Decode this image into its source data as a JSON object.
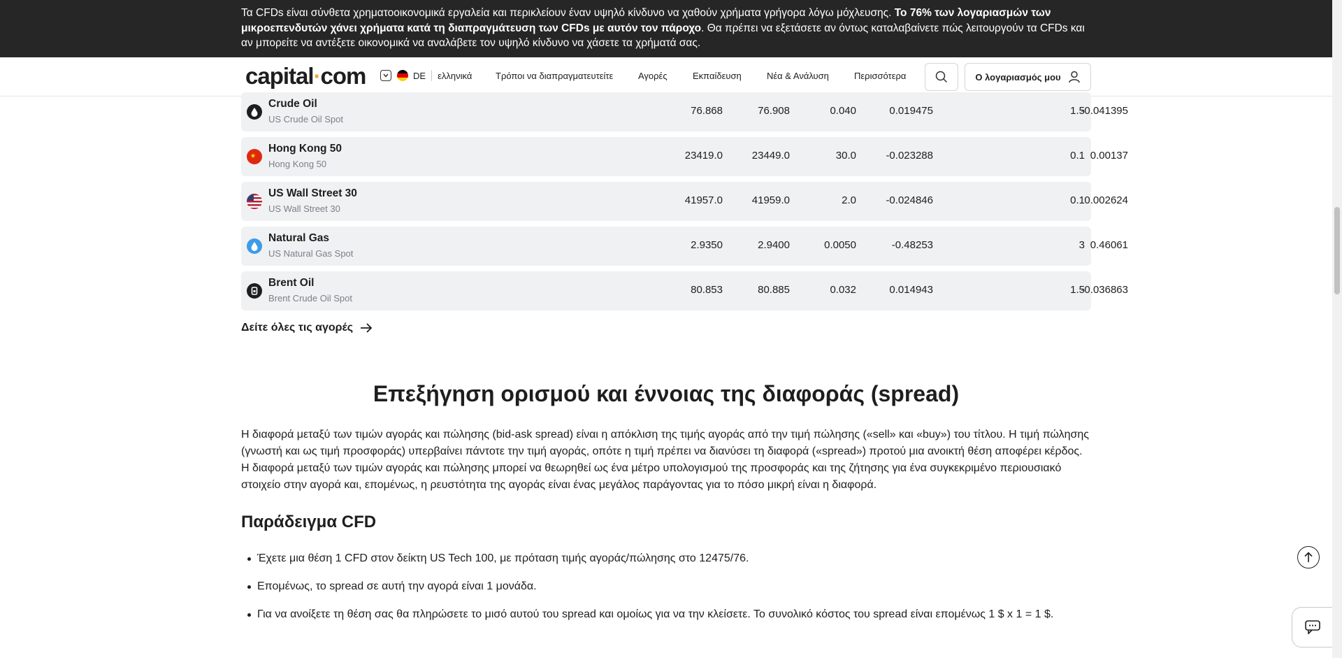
{
  "risk_banner": {
    "text_1": "Τα CFDs είναι σύνθετα χρηματοοικονομικά εργαλεία και περικλείουν έναν υψηλό κίνδυνο να χαθούν χρήματα γρήγορα λόγω μόχλευσης. ",
    "text_bold": "Το 76% των λογαριασμών των μικροεπενδυτών χάνει χρήματα κατά τη διαπραγμάτευση των CFDs με αυτόν τον πάροχο",
    "text_2": ". Θα πρέπει να εξετάσετε αν όντως καταλαβαίνετε πώς λειτουργούν τα CFDs και αν μπορείτε να αντέξετε οικονομικά να αναλάβετε τον υψηλό κίνδυνο να χάσετε τα χρήματά σας."
  },
  "header": {
    "logo_left": "capital",
    "logo_dot": "·",
    "logo_right": "com",
    "lang_code": "DE",
    "lang_name": "ελληνικά",
    "nav": [
      "Τρόποι να διαπραγματευτείτε",
      "Αγορές",
      "Εκπαίδευση",
      "Νέα & Ανάλυση",
      "Περισσότερα"
    ],
    "account_label": "Ο λογαριασμός μου"
  },
  "markets": [
    {
      "name": "Crude Oil",
      "sub": "US Crude Oil Spot",
      "sell": "76.868",
      "buy": "76.908",
      "spread": "0.040",
      "long": "0.019475",
      "short": "-0.041395",
      "margin": "1.5",
      "icon": "oil-drop-icon"
    },
    {
      "name": "Hong Kong 50",
      "sub": "Hong Kong 50",
      "sell": "23419.0",
      "buy": "23449.0",
      "spread": "30.0",
      "long": "-0.023288",
      "short": "0.00137",
      "margin": "0.1",
      "icon": "china-flag-icon"
    },
    {
      "name": "US Wall Street 30",
      "sub": "US Wall Street 30",
      "sell": "41957.0",
      "buy": "41959.0",
      "spread": "2.0",
      "long": "-0.024846",
      "short": "0.002624",
      "margin": "0.1",
      "icon": "us-flag-icon"
    },
    {
      "name": "Natural Gas",
      "sub": "US Natural Gas Spot",
      "sell": "2.9350",
      "buy": "2.9400",
      "spread": "0.0050",
      "long": "-0.48253",
      "short": "0.46061",
      "margin": "3",
      "icon": "gas-drop-icon"
    },
    {
      "name": "Brent Oil",
      "sub": "Brent Crude Oil Spot",
      "sell": "80.853",
      "buy": "80.885",
      "spread": "0.032",
      "long": "0.014943",
      "short": "-0.036863",
      "margin": "1.5",
      "icon": "barrel-icon"
    }
  ],
  "see_all_label": "Δείτε όλες τις αγορές",
  "section": {
    "title": "Επεξήγηση ορισμού και έννοιας της διαφοράς (spread)",
    "paragraph": "Η διαφορά μεταξύ των τιμών αγοράς και πώλησης (bid-ask spread) είναι η απόκλιση της τιμής αγοράς από την τιμή πώλησης («sell» και «buy») του τίτλου. Η τιμή πώλησης (γνωστή και ως τιμή προσφοράς) υπερβαίνει πάντοτε την τιμή αγοράς, οπότε η τιμή πρέπει να διανύσει τη διαφορά («spread») προτού μια ανοικτή θέση αποφέρει κέρδος. Η διαφορά μεταξύ των τιμών αγοράς και πώλησης μπορεί να θεωρηθεί ως ένα μέτρο υπολογισμού της προσφοράς και της ζήτησης για ένα συγκεκριμένο περιουσιακό στοιχείο στην αγορά και, επομένως, η ρευστότητα της αγοράς είναι ένας μεγάλος παράγοντας για το πόσο μικρή είναι η διαφορά.",
    "subtitle": "Παράδειγμα CFD",
    "bullets": [
      "Έχετε μια θέση 1 CFD στον δείκτη US Tech 100, με πρόταση τιμής αγοράς/πώλησης στο 12475/76.",
      "Επομένως, το spread σε αυτή την αγορά είναι 1 μονάδα.",
      "Για να ανοίξετε τη θέση σας θα πληρώσετε το μισό αυτού του spread και ομοίως για να την κλείσετε. Το συνολικό κόστος του spread είναι επομένως 1 $ x 1 = 1 $."
    ]
  },
  "colors": {
    "banner_bg": "#262626",
    "row_bg": "#f0f1f3",
    "logo_dot": "#f2a43a"
  }
}
